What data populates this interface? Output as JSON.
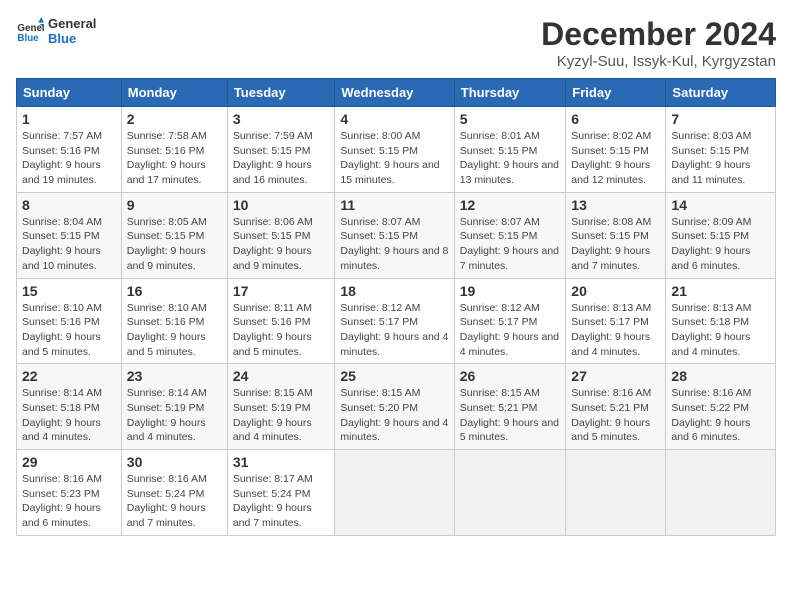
{
  "logo": {
    "line1": "General",
    "line2": "Blue"
  },
  "title": "December 2024",
  "subtitle": "Kyzyl-Suu, Issyk-Kul, Kyrgyzstan",
  "weekdays": [
    "Sunday",
    "Monday",
    "Tuesday",
    "Wednesday",
    "Thursday",
    "Friday",
    "Saturday"
  ],
  "weeks": [
    [
      {
        "day": "1",
        "info": "Sunrise: 7:57 AM\nSunset: 5:16 PM\nDaylight: 9 hours and 19 minutes."
      },
      {
        "day": "2",
        "info": "Sunrise: 7:58 AM\nSunset: 5:16 PM\nDaylight: 9 hours and 17 minutes."
      },
      {
        "day": "3",
        "info": "Sunrise: 7:59 AM\nSunset: 5:15 PM\nDaylight: 9 hours and 16 minutes."
      },
      {
        "day": "4",
        "info": "Sunrise: 8:00 AM\nSunset: 5:15 PM\nDaylight: 9 hours and 15 minutes."
      },
      {
        "day": "5",
        "info": "Sunrise: 8:01 AM\nSunset: 5:15 PM\nDaylight: 9 hours and 13 minutes."
      },
      {
        "day": "6",
        "info": "Sunrise: 8:02 AM\nSunset: 5:15 PM\nDaylight: 9 hours and 12 minutes."
      },
      {
        "day": "7",
        "info": "Sunrise: 8:03 AM\nSunset: 5:15 PM\nDaylight: 9 hours and 11 minutes."
      }
    ],
    [
      {
        "day": "8",
        "info": "Sunrise: 8:04 AM\nSunset: 5:15 PM\nDaylight: 9 hours and 10 minutes."
      },
      {
        "day": "9",
        "info": "Sunrise: 8:05 AM\nSunset: 5:15 PM\nDaylight: 9 hours and 9 minutes."
      },
      {
        "day": "10",
        "info": "Sunrise: 8:06 AM\nSunset: 5:15 PM\nDaylight: 9 hours and 9 minutes."
      },
      {
        "day": "11",
        "info": "Sunrise: 8:07 AM\nSunset: 5:15 PM\nDaylight: 9 hours and 8 minutes."
      },
      {
        "day": "12",
        "info": "Sunrise: 8:07 AM\nSunset: 5:15 PM\nDaylight: 9 hours and 7 minutes."
      },
      {
        "day": "13",
        "info": "Sunrise: 8:08 AM\nSunset: 5:15 PM\nDaylight: 9 hours and 7 minutes."
      },
      {
        "day": "14",
        "info": "Sunrise: 8:09 AM\nSunset: 5:15 PM\nDaylight: 9 hours and 6 minutes."
      }
    ],
    [
      {
        "day": "15",
        "info": "Sunrise: 8:10 AM\nSunset: 5:16 PM\nDaylight: 9 hours and 5 minutes."
      },
      {
        "day": "16",
        "info": "Sunrise: 8:10 AM\nSunset: 5:16 PM\nDaylight: 9 hours and 5 minutes."
      },
      {
        "day": "17",
        "info": "Sunrise: 8:11 AM\nSunset: 5:16 PM\nDaylight: 9 hours and 5 minutes."
      },
      {
        "day": "18",
        "info": "Sunrise: 8:12 AM\nSunset: 5:17 PM\nDaylight: 9 hours and 4 minutes."
      },
      {
        "day": "19",
        "info": "Sunrise: 8:12 AM\nSunset: 5:17 PM\nDaylight: 9 hours and 4 minutes."
      },
      {
        "day": "20",
        "info": "Sunrise: 8:13 AM\nSunset: 5:17 PM\nDaylight: 9 hours and 4 minutes."
      },
      {
        "day": "21",
        "info": "Sunrise: 8:13 AM\nSunset: 5:18 PM\nDaylight: 9 hours and 4 minutes."
      }
    ],
    [
      {
        "day": "22",
        "info": "Sunrise: 8:14 AM\nSunset: 5:18 PM\nDaylight: 9 hours and 4 minutes."
      },
      {
        "day": "23",
        "info": "Sunrise: 8:14 AM\nSunset: 5:19 PM\nDaylight: 9 hours and 4 minutes."
      },
      {
        "day": "24",
        "info": "Sunrise: 8:15 AM\nSunset: 5:19 PM\nDaylight: 9 hours and 4 minutes."
      },
      {
        "day": "25",
        "info": "Sunrise: 8:15 AM\nSunset: 5:20 PM\nDaylight: 9 hours and 4 minutes."
      },
      {
        "day": "26",
        "info": "Sunrise: 8:15 AM\nSunset: 5:21 PM\nDaylight: 9 hours and 5 minutes."
      },
      {
        "day": "27",
        "info": "Sunrise: 8:16 AM\nSunset: 5:21 PM\nDaylight: 9 hours and 5 minutes."
      },
      {
        "day": "28",
        "info": "Sunrise: 8:16 AM\nSunset: 5:22 PM\nDaylight: 9 hours and 6 minutes."
      }
    ],
    [
      {
        "day": "29",
        "info": "Sunrise: 8:16 AM\nSunset: 5:23 PM\nDaylight: 9 hours and 6 minutes."
      },
      {
        "day": "30",
        "info": "Sunrise: 8:16 AM\nSunset: 5:24 PM\nDaylight: 9 hours and 7 minutes."
      },
      {
        "day": "31",
        "info": "Sunrise: 8:17 AM\nSunset: 5:24 PM\nDaylight: 9 hours and 7 minutes."
      },
      null,
      null,
      null,
      null
    ]
  ]
}
